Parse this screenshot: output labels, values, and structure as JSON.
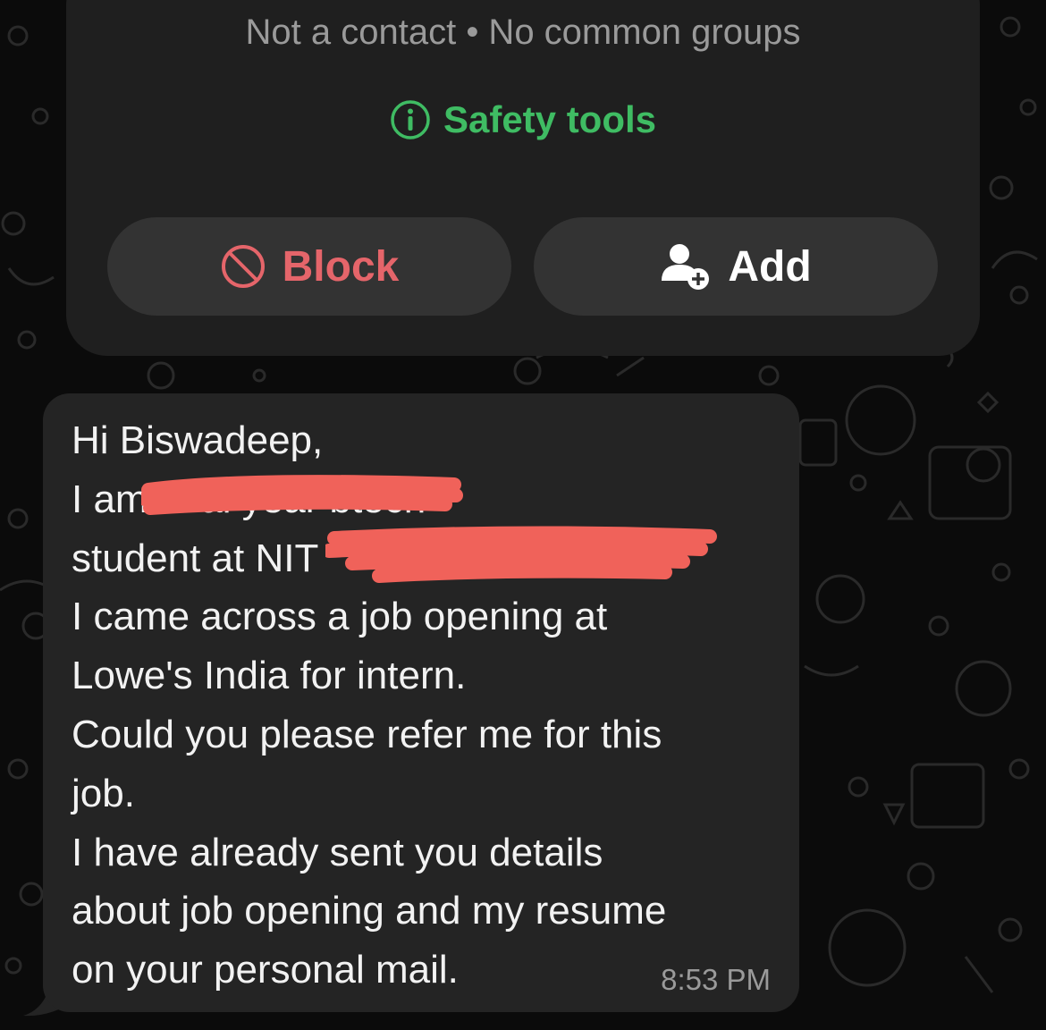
{
  "contact_card": {
    "subtitle": "Not a contact • No common groups",
    "safety_tools_label": "Safety tools",
    "block_label": "Block",
    "add_label": "Add"
  },
  "message": {
    "lines": [
      "Hi Biswadeep,",
      "I am                          final year btech",
      "student at NIT",
      "I came across a job opening at",
      "Lowe's India for intern.",
      "Could you please refer me for this",
      "job.",
      "I have already sent you details",
      "about job opening and my resume",
      "on your personal mail."
    ],
    "timestamp": "8:53 PM"
  },
  "colors": {
    "background": "#0b0b0b",
    "card": "#1f1f1f",
    "button": "#333333",
    "bubble": "#242424",
    "safety_green": "#3fbc63",
    "block_red": "#e5656a",
    "redaction": "#f0625a"
  },
  "icons": {
    "safety": "info-circle-icon",
    "block": "block-circle-icon",
    "add": "add-person-icon"
  }
}
